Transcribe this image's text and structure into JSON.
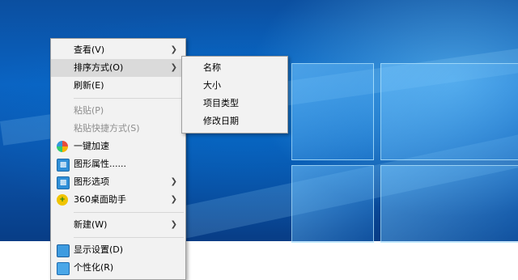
{
  "context_menu": {
    "items": [
      {
        "label": "查看(V)"
      },
      {
        "label": "排序方式(O)"
      },
      {
        "label": "刷新(E)"
      },
      {
        "label": "粘贴(P)"
      },
      {
        "label": "粘贴快捷方式(S)"
      },
      {
        "label": "一键加速"
      },
      {
        "label": "图形属性......"
      },
      {
        "label": "图形选项"
      },
      {
        "label": "360桌面助手"
      },
      {
        "label": "新建(W)"
      },
      {
        "label": "显示设置(D)"
      },
      {
        "label": "个性化(R)"
      }
    ]
  },
  "sort_submenu": {
    "items": [
      {
        "label": "名称"
      },
      {
        "label": "大小"
      },
      {
        "label": "项目类型"
      },
      {
        "label": "修改日期"
      }
    ]
  },
  "icons": {
    "submenu_arrow": "chevron-right-icon",
    "speed_up": "speed-up-icon",
    "graphics": "graphics-icon",
    "assistant_360": "360-assistant-icon",
    "display": "display-settings-icon",
    "personalize": "personalize-icon"
  },
  "colors": {
    "desktop_blue": "#0a63c2",
    "menu_background": "#f2f2f2",
    "selected_background": "#dadada",
    "disabled_text": "#8d8d8d"
  }
}
